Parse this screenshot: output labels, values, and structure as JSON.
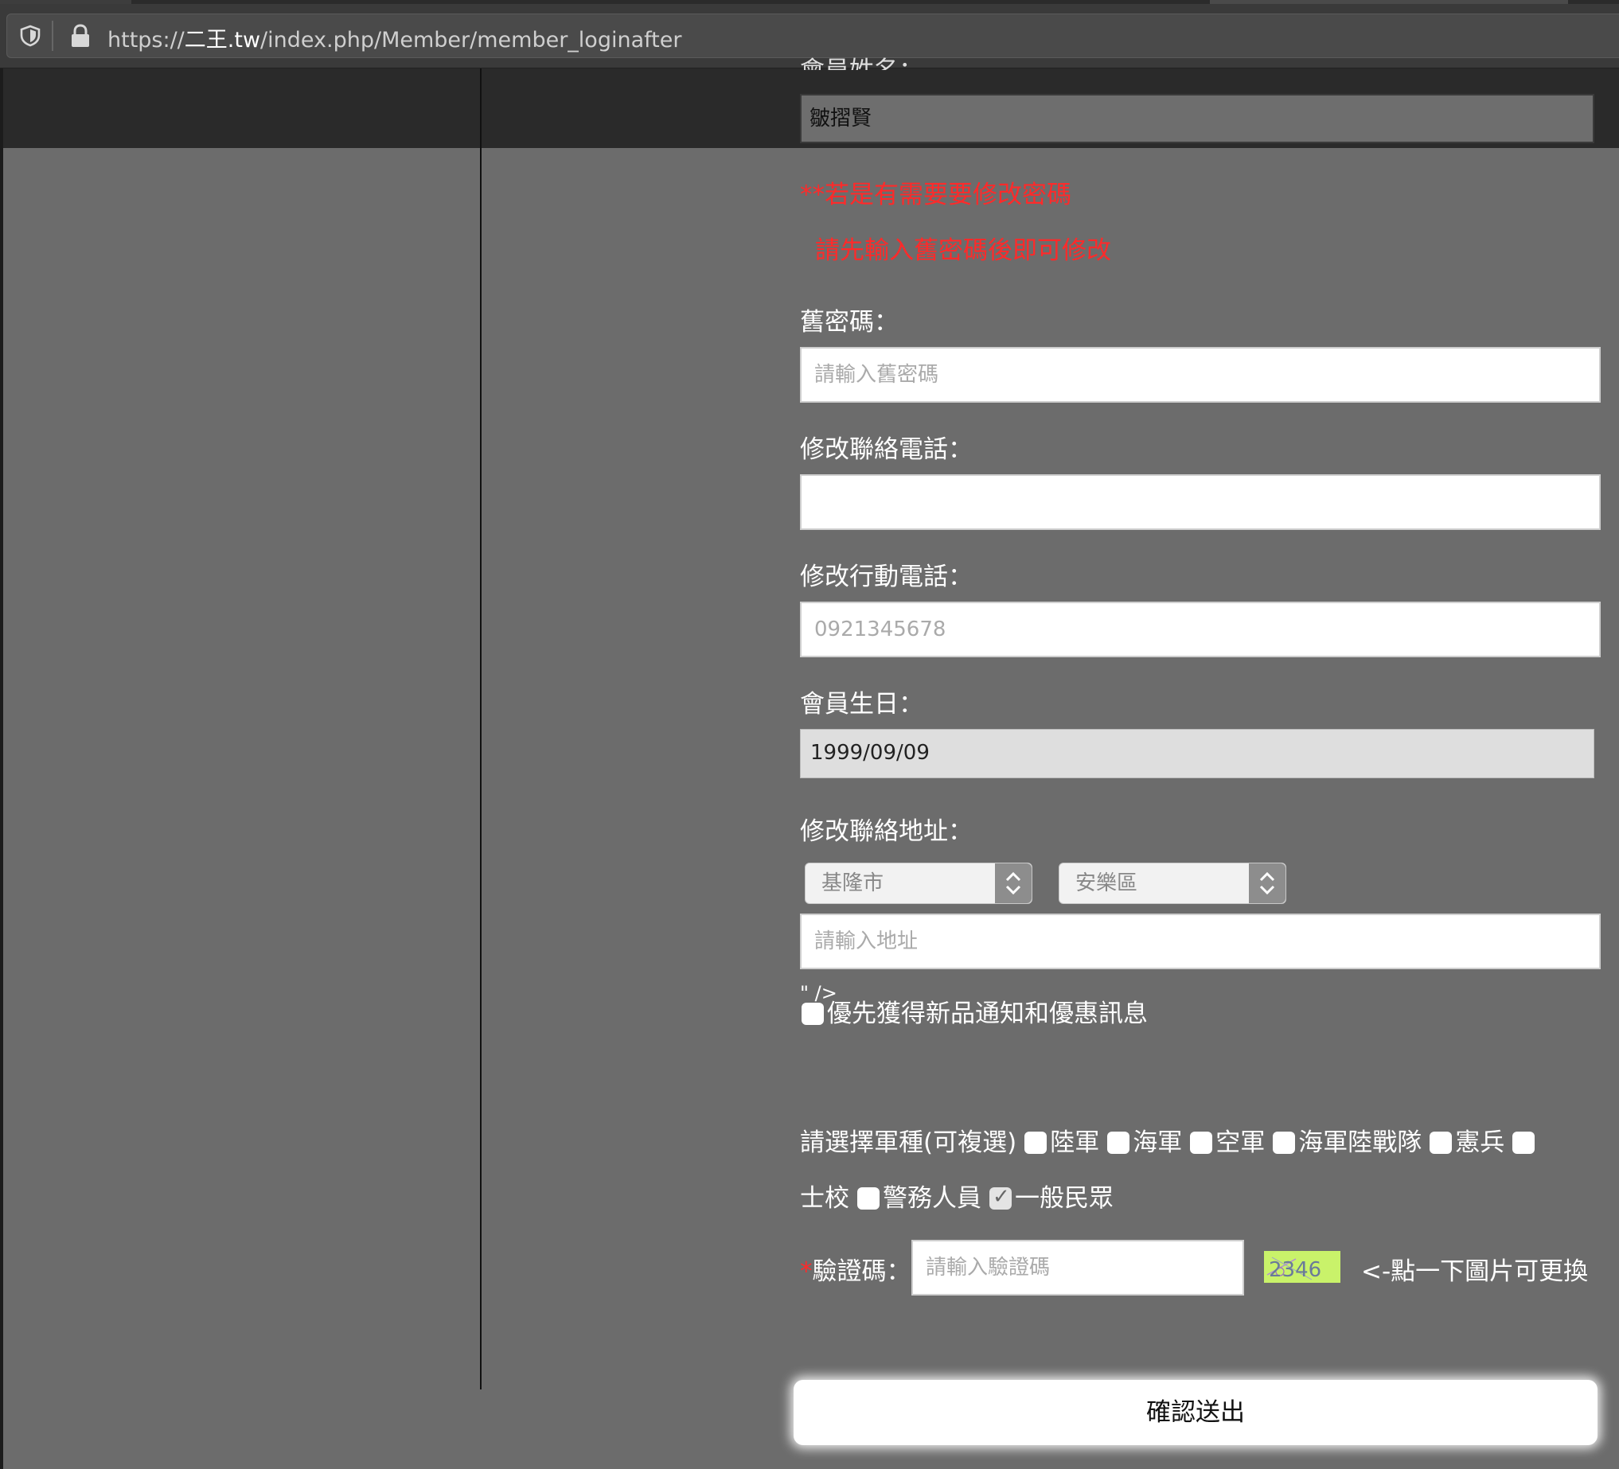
{
  "browser": {
    "url_prefix": "https://",
    "url_domain": "二王.tw",
    "url_path": "/index.php/Member/member_loginafter"
  },
  "form": {
    "name_label_partial": "會員姓名：",
    "name_value": "皺摺賢",
    "notice_line1": "**若是有需要要修改密碼",
    "notice_line2": "請先輸入舊密碼後即可修改",
    "old_password_label": "舊密碼：",
    "old_password_placeholder": "請輸入舊密碼",
    "phone_label": "修改聯絡電話：",
    "phone_value": "",
    "mobile_label": "修改行動電話：",
    "mobile_placeholder": "0921345678",
    "birthday_label": "會員生日：",
    "birthday_value": "1999/09/09",
    "address_label": "修改聯絡地址：",
    "city_selected": "基隆市",
    "district_selected": "安樂區",
    "address_placeholder": "請輸入地址",
    "stray_markup": "\" />",
    "newsletter_label": "優先獲得新品通知和優惠訊息",
    "military_prompt": "請選擇軍種(可複選)",
    "military_options": [
      "陸軍",
      "海軍",
      "空軍",
      "海軍陸戰隊",
      "憲兵",
      "士校",
      "警務人員",
      "一般民眾"
    ],
    "captcha_required_mark": "*",
    "captcha_label": "驗證碼：",
    "captcha_placeholder": "請輸入驗證碼",
    "captcha_image_text": "2346",
    "captcha_hint": "<-點一下圖片可更換",
    "submit_label": "確認送出"
  },
  "colors": {
    "page_bg": "#6c6c6c",
    "notice_red": "#ff2a2a",
    "captcha_bg": "#c9f26a"
  }
}
